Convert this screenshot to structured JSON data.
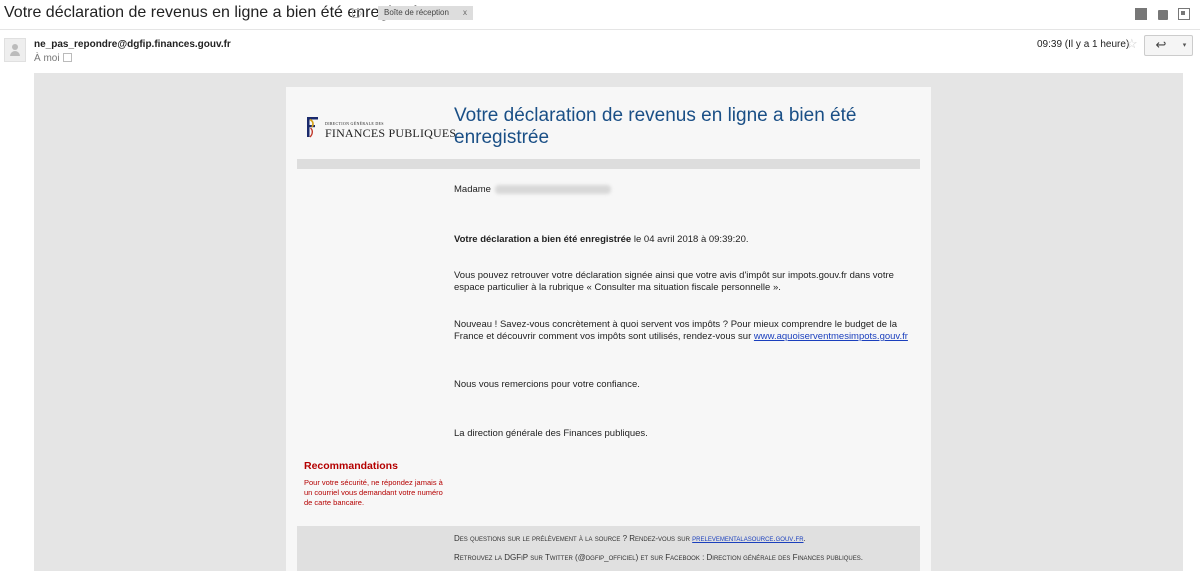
{
  "email": {
    "subject": "Votre déclaration de revenus en ligne a bien été enregistrée",
    "label_chip": "Boîte de réception",
    "label_chip_close": "x",
    "sender": "ne_pas_repondre@dgfip.finances.gouv.fr",
    "to_line": "À moi",
    "time": "09:39 (Il y a 1 heure)",
    "star": "☆",
    "reply_icon": "reply-icon",
    "reply_glyph": "↩",
    "more_glyph": "▾"
  },
  "top_icons": [
    "archive-icon",
    "print-icon",
    "popout-icon"
  ],
  "body": {
    "logo_small": "DIRECTION GÉNÉRALE DES",
    "logo_big": "FINANCES PUBLIQUES",
    "title": "Votre déclaration de revenus en ligne a bien été enregistrée",
    "salutation": "Madame",
    "registered_bold": "Votre déclaration a bien été enregistrée",
    "registered_rest": " le 04 avril 2018 à 09:39:20.",
    "retrieve": "Vous pouvez retrouver votre déclaration signée ainsi que votre avis d'impôt sur impots.gouv.fr dans votre espace particulier à la rubrique « Consulter ma situation fiscale personnelle ».",
    "news_text": "Nouveau ! Savez-vous concrètement à quoi servent vos impôts ? Pour mieux comprendre le budget de la France et découvrir comment vos impôts sont utilisés, rendez-vous sur ",
    "news_link": "www.aquoiserventmesimpots.gouv.fr",
    "thanks": "Nous vous remercions pour votre confiance.",
    "signature": "La direction générale des Finances publiques.",
    "rec_title": "Recommandations",
    "rec_text": "Pour votre sécurité, ne répondez jamais à un courriel vous demandant votre numéro de carte bancaire.",
    "footer_1_text": "Des questions sur le prélèvement à la source ? Rendez-vous sur ",
    "footer_1_link": "prelevementalasource.gouv.fr",
    "footer_1_end": ".",
    "footer_2": "Retrouvez la DGFiP sur Twitter (@dgfip_officiel) et sur Facebook : Direction générale des Finances publiques."
  },
  "colors": {
    "title_blue": "#1a4f86",
    "recommendation_red": "#b40000",
    "link_blue": "#1a3fbd",
    "canvas_grey": "#e5e5e5"
  }
}
